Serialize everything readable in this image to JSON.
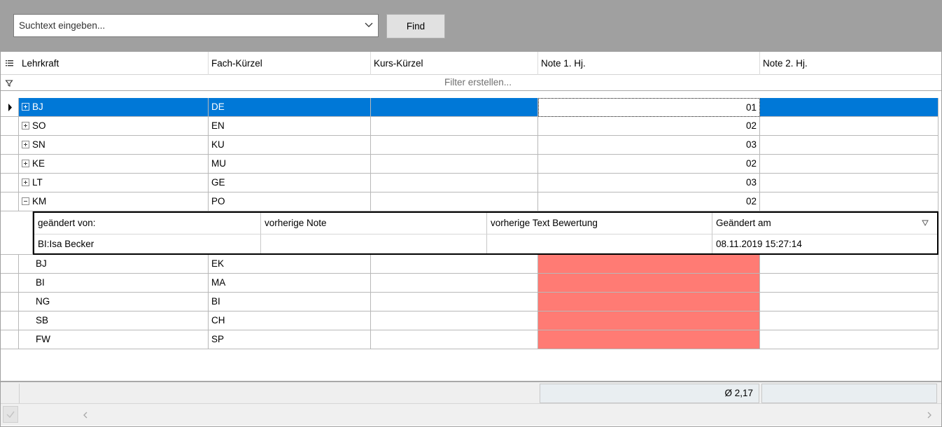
{
  "search": {
    "placeholder": "Suchtext eingeben...",
    "find_label": "Find"
  },
  "columns": [
    "Lehrkraft",
    "Fach-Kürzel",
    "Kurs-Kürzel",
    "Note 1. Hj.",
    "Note 2. Hj."
  ],
  "filter": {
    "placeholder": "Filter erstellen..."
  },
  "rows": [
    {
      "lehrkraft": "BJ",
      "fach": "DE",
      "kurs": "",
      "note1": "01",
      "note2": ""
    },
    {
      "lehrkraft": "SO",
      "fach": "EN",
      "kurs": "",
      "note1": "02",
      "note2": ""
    },
    {
      "lehrkraft": "SN",
      "fach": "KU",
      "kurs": "",
      "note1": "03",
      "note2": ""
    },
    {
      "lehrkraft": "KE",
      "fach": "MU",
      "kurs": "",
      "note1": "02",
      "note2": ""
    },
    {
      "lehrkraft": "LT",
      "fach": "GE",
      "kurs": "",
      "note1": "03",
      "note2": ""
    },
    {
      "lehrkraft": "KM",
      "fach": "PO",
      "kurs": "",
      "note1": "02",
      "note2": ""
    },
    {
      "lehrkraft": "BJ",
      "fach": "EK",
      "kurs": "",
      "note1": "",
      "note2": ""
    },
    {
      "lehrkraft": "BI",
      "fach": "MA",
      "kurs": "",
      "note1": "",
      "note2": ""
    },
    {
      "lehrkraft": "NG",
      "fach": "BI",
      "kurs": "",
      "note1": "",
      "note2": ""
    },
    {
      "lehrkraft": "SB",
      "fach": "CH",
      "kurs": "",
      "note1": "",
      "note2": ""
    },
    {
      "lehrkraft": "FW",
      "fach": "SP",
      "kurs": "",
      "note1": "",
      "note2": ""
    }
  ],
  "detail": {
    "columns": [
      "geändert von:",
      "vorherige Note",
      "vorherige Text Bewertung",
      "Geändert am"
    ],
    "row": {
      "geaendert_von": "BI:Isa Becker",
      "vorherige_note": "",
      "vorherige_text": "",
      "geaendert_am": "08.11.2019 15:27:14"
    }
  },
  "footer": {
    "average": "Ø 2,17"
  },
  "colors": {
    "selection": "#0078d7",
    "missing_grade": "#ff7b74",
    "topbar": "#a0a0a0"
  }
}
